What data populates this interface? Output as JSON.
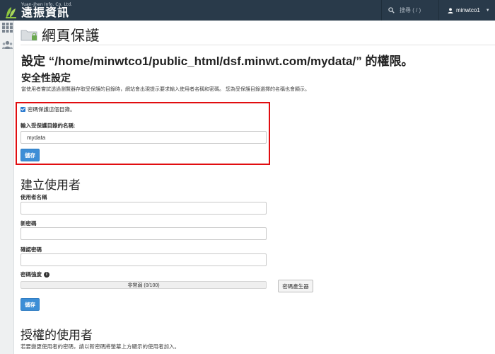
{
  "topbar": {
    "logo_en": "Yuan-Jhen Info. Co. Ltd.",
    "logo_zh": "遠振資訊",
    "search_placeholder": "搜尋 ( / )",
    "username": "minwtco1"
  },
  "page": {
    "title": "網頁保護",
    "permission_heading": "設定 “/home/minwtco1/public_html/dsf.minwt.com/mydata/” 的權限。"
  },
  "security": {
    "heading": "安全性設定",
    "description": "當使用者嘗試透過瀏覽器存取受保護的目錄時，網站會出現提示要求輸入使用者名稱和密碼。 您為受保護目錄選擇的名稱也會顯示。",
    "checkbox_label": "密碼保護這個目錄。",
    "checkbox_checked": true,
    "dir_name_label": "輸入受保護目錄的名稱:",
    "dir_name_value": "mydata",
    "save_label": "儲存"
  },
  "create_user": {
    "heading": "建立使用者",
    "username_label": "使用者名稱",
    "password_label": "新密碼",
    "confirm_label": "確認密碼",
    "strength_label": "密碼強度",
    "strength_text": "非常弱 (0/100)",
    "strength_value": 0,
    "generator_label": "密碼產生器",
    "save_label": "儲存"
  },
  "authorized": {
    "heading": "授權的使用者",
    "description": "若要變更使用者的密碼，請以新密碼將螢幕上方顯示的使用者加入。"
  },
  "colors": {
    "topbar": "#293a4a",
    "accent": "#3d8ed6",
    "highlight": "#e10d10",
    "logo_green": "#8dc63f"
  }
}
